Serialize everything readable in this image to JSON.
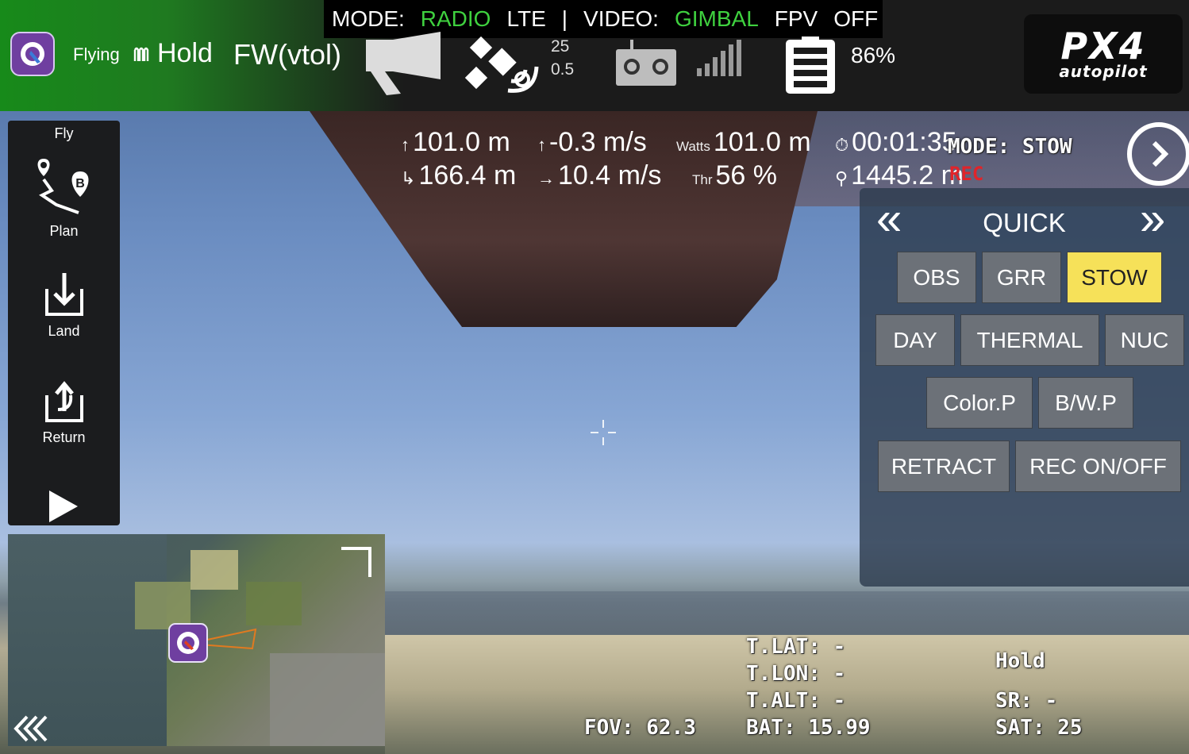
{
  "top_bar": {
    "mode_label": "MODE:",
    "mode_radio": "RADIO",
    "mode_lte": "LTE",
    "separator": "|",
    "video_label": "VIDEO:",
    "video_gimbal": "GIMBAL",
    "video_fpv": "FPV",
    "video_off": "OFF",
    "flight_status": "Flying",
    "flight_mode": "Hold",
    "vehicle_type": "FW(vtol)",
    "gps_sat_count": "25",
    "gps_hdop": "0.5",
    "battery_percent": "86%",
    "brand_logo_top": "PX4",
    "brand_logo_bottom": "autopilot"
  },
  "tool_strip": {
    "items": [
      {
        "label": "Fly"
      },
      {
        "label": "Plan"
      },
      {
        "label": "Land"
      },
      {
        "label": "Return"
      }
    ]
  },
  "telemetry": {
    "altitude": "101.0 m",
    "vertical_speed": "-0.3 m/s",
    "watts_label": "Watts",
    "watts_value": "101.0 m",
    "flight_time": "00:01:35",
    "distance_home": "166.4 m",
    "ground_speed": "10.4 m/s",
    "throttle_label": "Thr",
    "throttle_value": "56 %",
    "distance_walked": "1445.2 m"
  },
  "osd": {
    "mode_text": "MODE: STOW",
    "rec_text": "REC",
    "t_lat": "T.LAT: -",
    "t_lon": "T.LON: -",
    "t_alt": "T.ALT: -",
    "fov": "FOV: 62.3",
    "bat": "BAT: 15.99",
    "hold": "Hold",
    "sr": "SR: -",
    "sat": "SAT: 25"
  },
  "quick_panel": {
    "title": "QUICK",
    "prev_glyph": "«",
    "next_glyph": "»",
    "buttons": {
      "obs": "OBS",
      "grr": "GRR",
      "stow": "STOW",
      "day": "DAY",
      "thermal": "THERMAL",
      "nuc": "NUC",
      "colorp": "Color.P",
      "bwp": "B/W.P",
      "retract": "RETRACT",
      "rec": "REC ON/OFF"
    },
    "active_button": "STOW",
    "active_color": "#f6e159"
  },
  "colors": {
    "status_green": "#3fd13f",
    "topbar_green": "#178a1a",
    "app_purple": "#6f3fa0"
  }
}
